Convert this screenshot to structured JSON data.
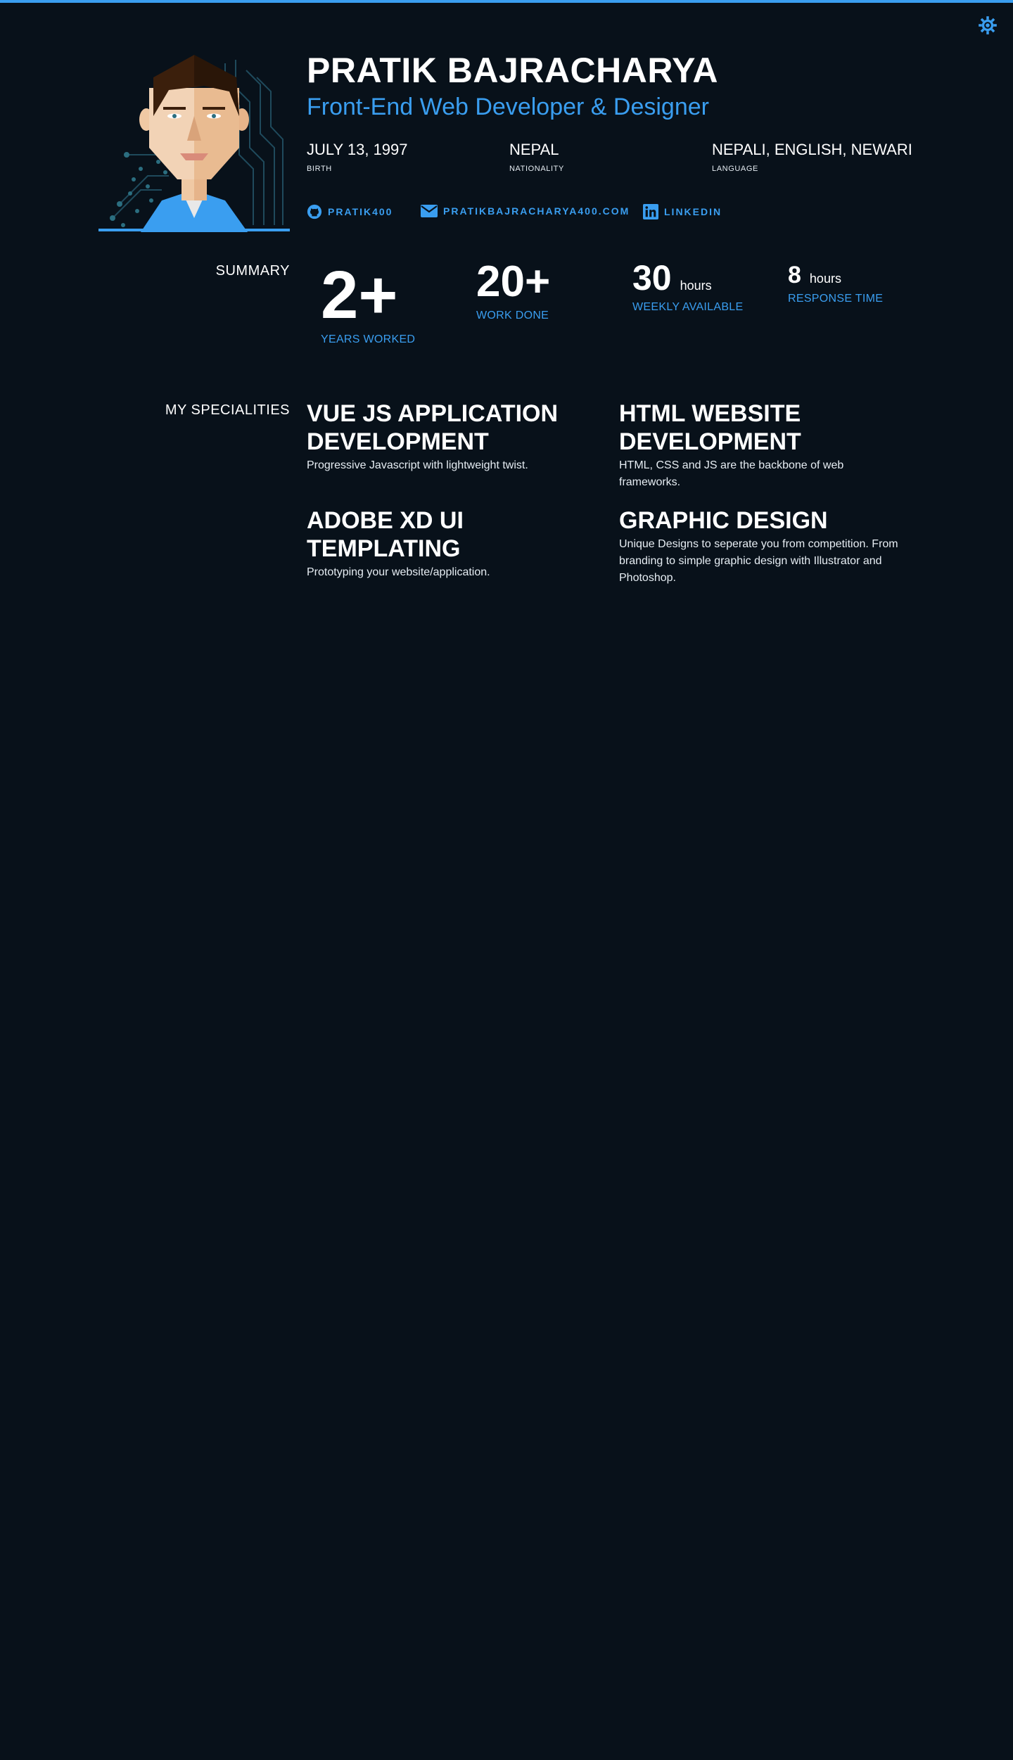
{
  "colors": {
    "background": "#08111a",
    "accent": "#3a9ef0",
    "text": "#ffffff"
  },
  "header": {
    "theme_toggle_icon": "sun-settings-icon"
  },
  "profile": {
    "name": "PRATIK BAJRACHARYA",
    "role": "Front-End Web Developer & Designer",
    "avatar_icon": "avatar-illustration"
  },
  "facts": [
    {
      "value": "JULY 13, 1997",
      "label": "BIRTH"
    },
    {
      "value": "NEPAL",
      "label": "NATIONALITY"
    },
    {
      "value": "NEPALI, ENGLISH, NEWARI",
      "label": "LANGUAGE"
    }
  ],
  "contacts": [
    {
      "icon": "github-icon",
      "label": "PRATIK400"
    },
    {
      "icon": "envelope-icon",
      "label": "PRATIKBAJRACHARYA400.COM"
    },
    {
      "icon": "linkedin-icon",
      "label": "LINKEDIN"
    }
  ],
  "summary": {
    "title": "SUMMARY",
    "stats": [
      {
        "value": "2+",
        "unit": "",
        "label": "YEARS WORKED"
      },
      {
        "value": "20+",
        "unit": "",
        "label": "WORK DONE"
      },
      {
        "value": "30",
        "unit": "hours",
        "label": "WEEKLY AVAILABLE"
      },
      {
        "value": "8",
        "unit": "hours",
        "label": "RESPONSE TIME"
      }
    ]
  },
  "specialities": {
    "title": "MY SPECIALITIES",
    "items": [
      {
        "title": "VUE JS APPLICATION DEVELOPMENT",
        "desc": "Progressive Javascript with lightweight twist."
      },
      {
        "title": "HTML WEBSITE DEVELOPMENT",
        "desc": "HTML, CSS and JS are the backbone of web frameworks."
      },
      {
        "title": "ADOBE XD UI TEMPLATING",
        "desc": "Prototyping your website/application."
      },
      {
        "title": "GRAPHIC DESIGN",
        "desc": "Unique Designs to seperate you from competition. From branding to simple graphic design with Illustrator and Photoshop."
      }
    ]
  }
}
